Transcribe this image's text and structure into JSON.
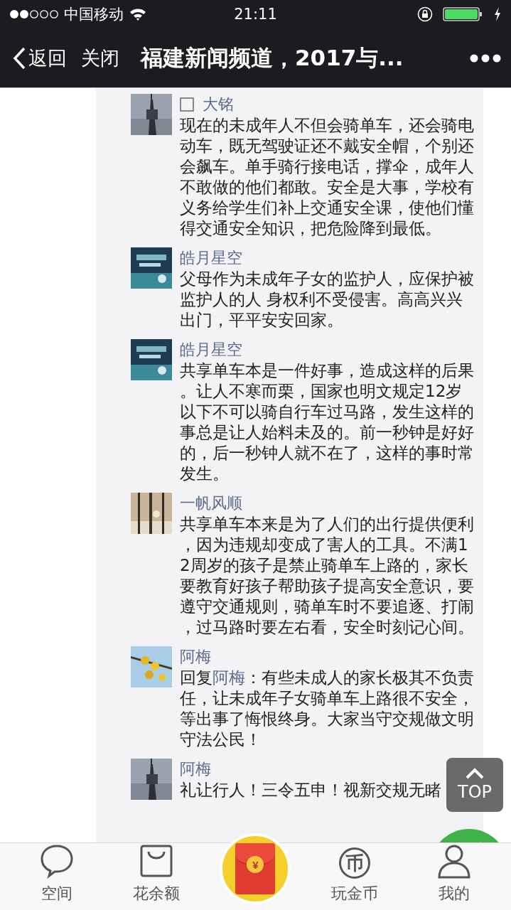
{
  "status_bar": {
    "carrier": "中国移动",
    "time": "21:11"
  },
  "nav_bar": {
    "back": "返回",
    "close": "关闭",
    "title": "福建新闻频道，2017与..."
  },
  "comments": [
    {
      "name": "大铭",
      "badge_icon": true,
      "text": "现在的未成年人不但会骑单车，还会骑电动车，既无驾驶证还不戴安全帽，个别还会飙车。单手骑行接电话，撑伞，成年人不敢做的他们都敢。安全是大事，学校有义务给学生们补上交通安全课，使他们懂得交通安全知识，把危险降到最低。"
    },
    {
      "name": "皓月星空",
      "badge_icon": false,
      "text": "父母作为未成年子女的监护人，应保护被监护人的人 身权利不受侵害。高高兴兴出门，平平安安回家。"
    },
    {
      "name": "皓月星空",
      "badge_icon": false,
      "text": "共享单车本是一件好事，造成这样的后果。让人不寒而栗，国家也明文规定12岁以下不可以骑自行车过马路，发生这样的事总是让人始料未及的。前一秒钟是好好的，后一秒钟人就不在了，这样的事时常发生。"
    },
    {
      "name": "一帆风顺",
      "badge_icon": false,
      "text": "共享单车本来是为了人们的出行提供便利，因为违规却变成了害人的工具。不满12周岁的孩子是禁止骑单车上路的，家长要教育好孩子帮助孩子提高安全意识，要遵守交通规则，骑单车时不要追逐、打闹，过马路时要左右看，安全时刻记心间。"
    },
    {
      "name": "阿梅",
      "badge_icon": false,
      "reply_prefix": "回复",
      "reply_to": "阿梅",
      "text": "：有些未成人的家长极其不负责任，让未成年子女骑单车上路很不安全，等出事了悔恨终身。大家当守交规做文明守法公民！"
    },
    {
      "name": "阿梅",
      "badge_icon": false,
      "text": "礼让行人！三令五申！视新交规无睹"
    }
  ],
  "top_button": {
    "label": "TOP"
  },
  "red_packet": {
    "symbol": "¥"
  },
  "tab_bar": [
    {
      "kind": "chat",
      "label": "空间"
    },
    {
      "kind": "bag",
      "label": "花余额"
    },
    {
      "kind": "packet"
    },
    {
      "kind": "coin",
      "label": "玩金币",
      "icon_text": "币"
    },
    {
      "kind": "person",
      "label": "我的"
    }
  ]
}
